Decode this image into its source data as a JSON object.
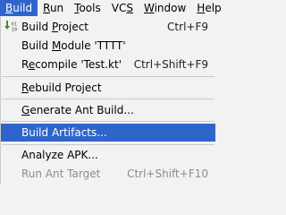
{
  "menubar": {
    "items": [
      {
        "pre": "",
        "mn": "B",
        "post": "uild"
      },
      {
        "pre": "",
        "mn": "R",
        "post": "un"
      },
      {
        "pre": "",
        "mn": "T",
        "post": "ools"
      },
      {
        "pre": "VC",
        "mn": "S",
        "post": ""
      },
      {
        "pre": "",
        "mn": "W",
        "post": "indow"
      },
      {
        "pre": "",
        "mn": "H",
        "post": "elp"
      }
    ]
  },
  "build_menu": {
    "build_project": {
      "pre": "Build ",
      "mn": "P",
      "post": "roject",
      "shortcut": "Ctrl+F9",
      "icon": "build-project-icon"
    },
    "build_module": {
      "pre": "Build ",
      "mn": "M",
      "post": "odule 'TTTT'"
    },
    "recompile": {
      "pre": "R",
      "mn": "e",
      "post": "compile 'Test.kt'",
      "shortcut": "Ctrl+Shift+F9"
    },
    "rebuild_project": {
      "pre": "",
      "mn": "R",
      "post": "ebuild Project"
    },
    "generate_ant_build": {
      "pre": "",
      "mn": "G",
      "post": "enerate Ant Build..."
    },
    "build_artifacts": {
      "pre": "Build Artifacts...",
      "mn": "",
      "post": ""
    },
    "analyze_apk": {
      "pre": "Analyze APK...",
      "mn": "",
      "post": ""
    },
    "run_ant_target": {
      "pre": "Run Ant Target",
      "mn": "",
      "post": "",
      "shortcut": "Ctrl+Shift+F10"
    }
  },
  "colors": {
    "selection": "#2f65ca",
    "menu_background": "#f2f2f2",
    "disabled_text": "#8c8c8c"
  }
}
